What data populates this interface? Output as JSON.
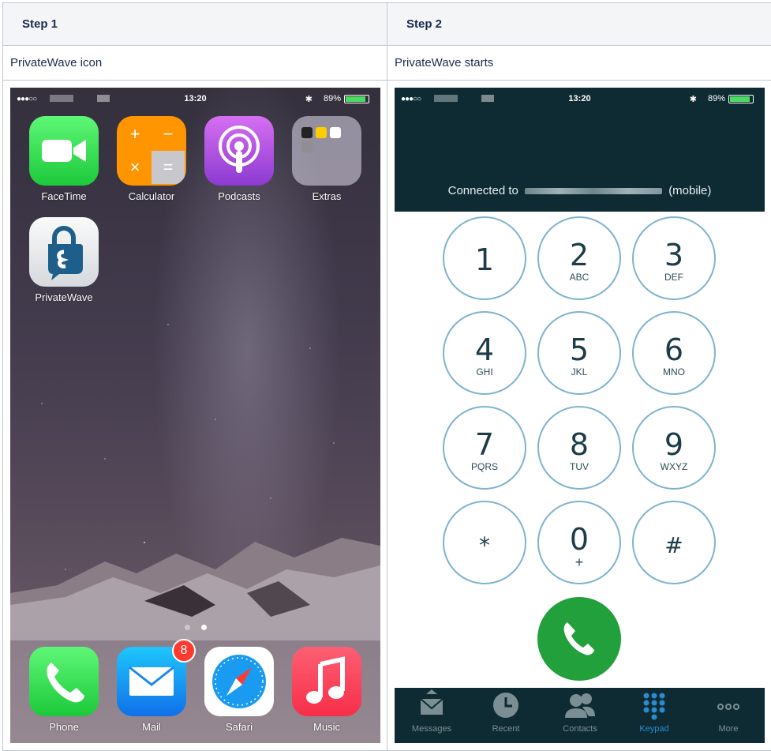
{
  "table": {
    "headers": [
      "Step 1",
      "Step 2"
    ],
    "captions": [
      "PrivateWave icon",
      "PrivateWave starts"
    ]
  },
  "status": {
    "time": "13:20",
    "battery": "89%",
    "battery_level": 0.89
  },
  "home": {
    "apps": [
      "FaceTime",
      "Calculator",
      "Podcasts",
      "Extras",
      "PrivateWave"
    ],
    "dock": [
      "Phone",
      "Mail",
      "Safari",
      "Music"
    ],
    "mail_badge": "8",
    "page_count": 2,
    "active_page": 2
  },
  "dialer": {
    "connected_prefix": "Connected to",
    "connected_suffix": "(mobile)",
    "keys": [
      {
        "digit": "1",
        "letters": ""
      },
      {
        "digit": "2",
        "letters": "ABC"
      },
      {
        "digit": "3",
        "letters": "DEF"
      },
      {
        "digit": "4",
        "letters": "GHI"
      },
      {
        "digit": "5",
        "letters": "JKL"
      },
      {
        "digit": "6",
        "letters": "MNO"
      },
      {
        "digit": "7",
        "letters": "PQRS"
      },
      {
        "digit": "8",
        "letters": "TUV"
      },
      {
        "digit": "9",
        "letters": "WXYZ"
      },
      {
        "digit": "*",
        "letters": ""
      },
      {
        "digit": "0",
        "letters": "+"
      },
      {
        "digit": "#",
        "letters": ""
      }
    ],
    "tabs": [
      "Messages",
      "Recent",
      "Contacts",
      "Keypad",
      "More"
    ],
    "active_tab": "Keypad"
  },
  "colors": {
    "header_bg": "#0e2b33",
    "key_border": "#7fb3cf",
    "call_green": "#22a03c",
    "active_tab": "#2c8ad0",
    "badge_red": "#ff3b30"
  }
}
